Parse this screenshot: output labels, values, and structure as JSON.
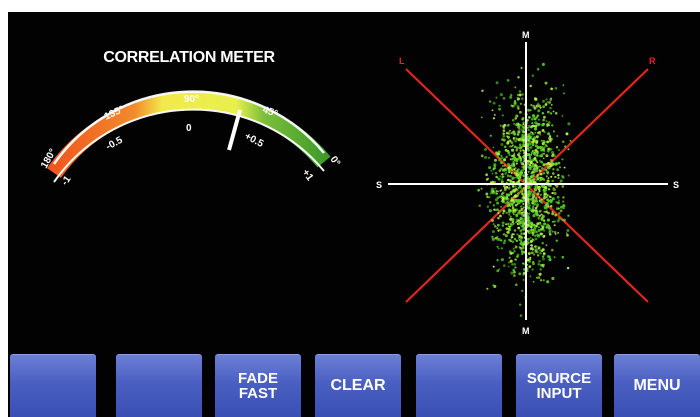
{
  "meter": {
    "title": "CORRELATION METER",
    "degree_labels": [
      "180°",
      "135°",
      "90°",
      "45°",
      "0°"
    ],
    "value_labels": [
      "-1",
      "-0.5",
      "0",
      "+0.5",
      "+1"
    ],
    "needle_value": 0.45
  },
  "scope": {
    "top_label": "M",
    "bottom_label": "M",
    "left_label": "S",
    "right_label": "S",
    "left_channel": "L",
    "right_channel": "R"
  },
  "softkeys": {
    "key1": "",
    "key2": "",
    "key3_line1": "FADE",
    "key3_line2": "FAST",
    "key4": "CLEAR",
    "key5": "",
    "key6_line1": "SOURCE",
    "key6_line2": "INPUT",
    "key7": "MENU"
  },
  "colors": {
    "background": "#020202",
    "arc_red": "#f0511d",
    "arc_yellow": "#f2ea4a",
    "arc_green": "#4ea82f",
    "diagonal_red": "#e0261d",
    "scatter_green": "#6eea2c",
    "key_blue": "#4a5fc2"
  }
}
